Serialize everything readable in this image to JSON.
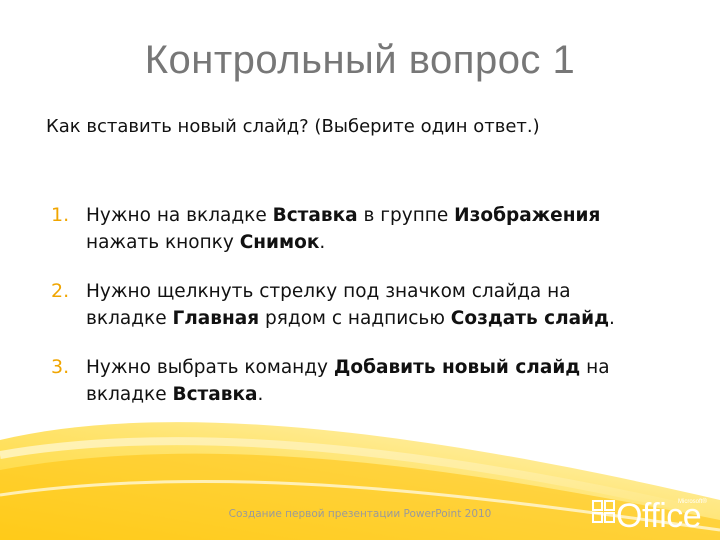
{
  "slide": {
    "title": "Контрольный вопрос 1",
    "question": "Как вставить новый слайд? (Выберите один ответ.)",
    "answers": [
      {
        "number": "1.",
        "line1": [
          "Нужно на вкладке ",
          "Вставка",
          " в группе ",
          "Изображения"
        ],
        "line2": [
          "нажать кнопку ",
          "Снимок",
          "."
        ]
      },
      {
        "number": "2.",
        "line1": [
          "Нужно щелкнуть стрелку под значком слайда на"
        ],
        "line2": [
          "вкладке ",
          "Главная",
          " рядом с надписью ",
          "Создать слайд",
          "."
        ]
      },
      {
        "number": "3.",
        "line1": [
          "Нужно выбрать команду ",
          "Добавить новый слайд",
          " на"
        ],
        "line2": [
          "вкладке ",
          "Вставка",
          "."
        ]
      }
    ],
    "footer": "Создание первой презентации PowerPoint 2010"
  },
  "logo": {
    "word": "Office",
    "brand": "Microsoft®"
  },
  "colors": {
    "accent": "#f0a500",
    "title": "#777777",
    "text": "#111111",
    "footer": "#9a9a9a"
  }
}
